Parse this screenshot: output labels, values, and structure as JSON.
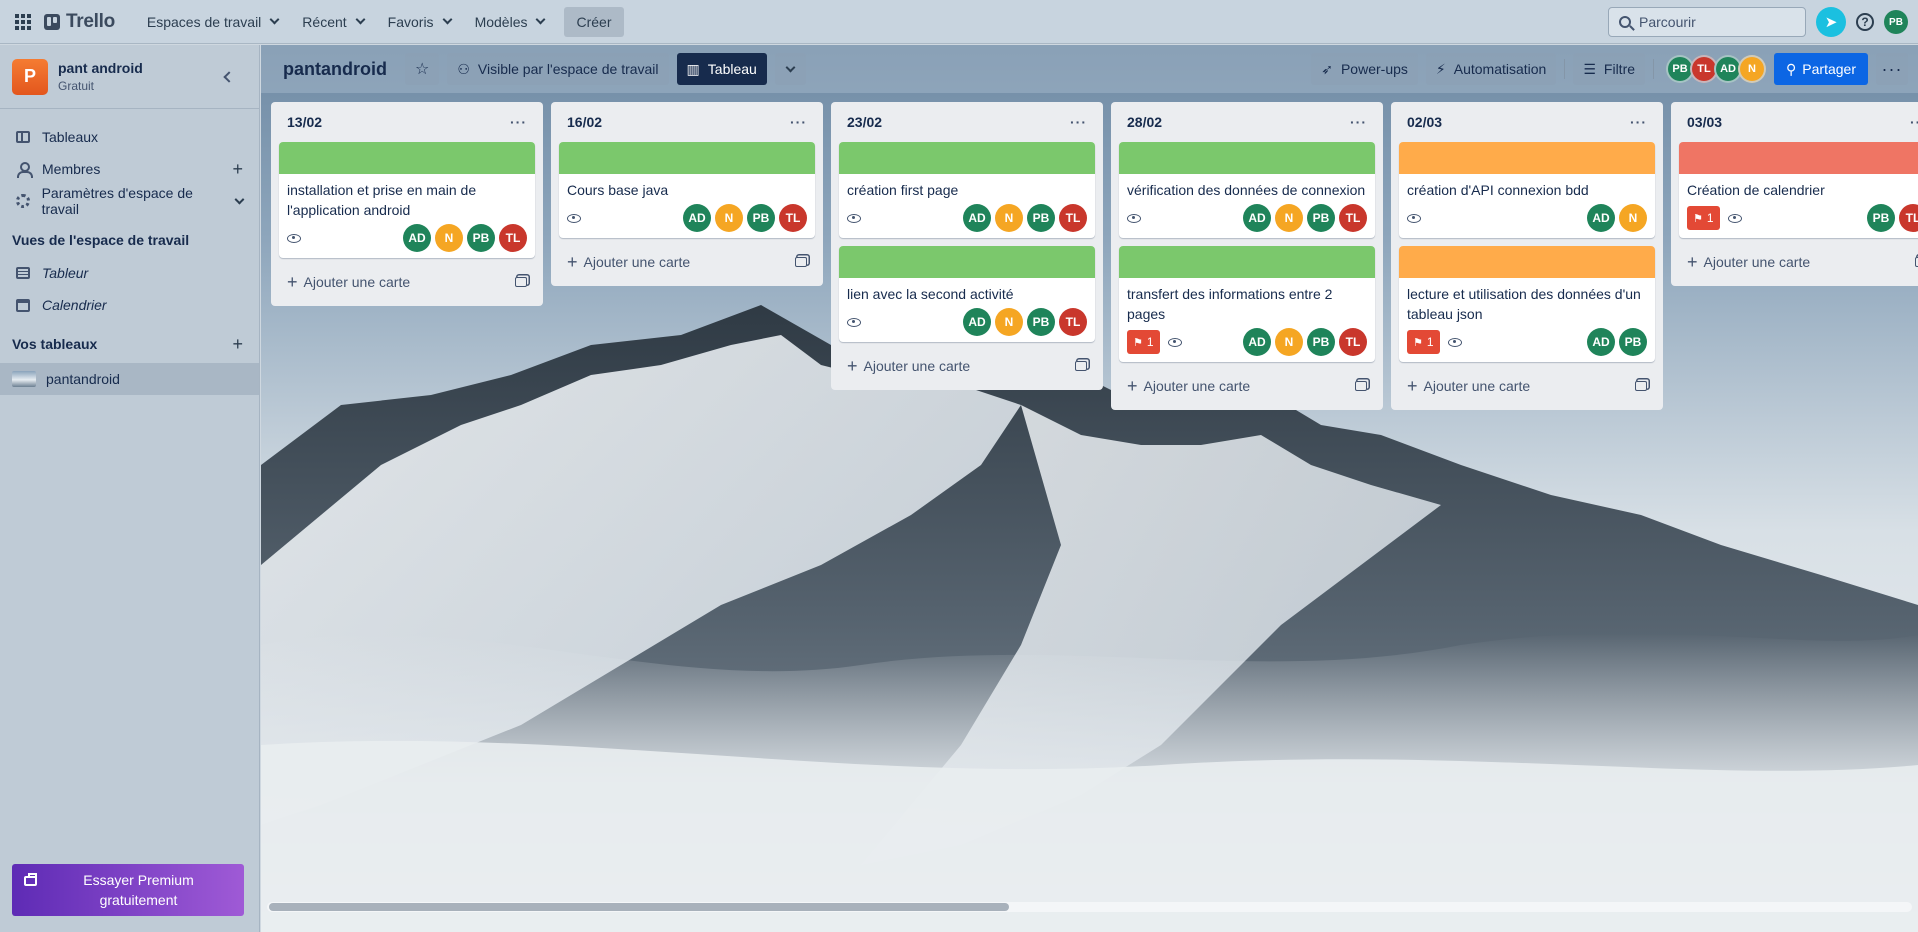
{
  "app": {
    "logo": "Trello"
  },
  "topnav": {
    "items": [
      "Espaces de travail",
      "Récent",
      "Favoris",
      "Modèles"
    ],
    "create": "Créer"
  },
  "search": {
    "placeholder": "Parcourir"
  },
  "current_user": {
    "initials": "PB",
    "color": "#1f845a"
  },
  "sidebar": {
    "workspace_initial": "P",
    "workspace_name": "pant android",
    "workspace_plan": "Gratuit",
    "items": [
      "Tableaux",
      "Membres",
      "Paramètres d'espace de travail"
    ],
    "views_title": "Vues de l'espace de travail",
    "views": [
      "Tableur",
      "Calendrier"
    ],
    "boards_title": "Vos tableaux",
    "boards": [
      "pantandroid"
    ],
    "premium": "Essayer Premium gratuitement"
  },
  "board": {
    "title": "pantandroid",
    "visibility": "Visible par l'espace de travail",
    "view": "Tableau",
    "powerups": "Power-ups",
    "automation": "Automatisation",
    "filter": "Filtre",
    "share": "Partager",
    "members": [
      {
        "initials": "PB",
        "color": "#1f845a"
      },
      {
        "initials": "TL",
        "color": "#c9372c"
      },
      {
        "initials": "AD",
        "color": "#1f845a"
      },
      {
        "initials": "N",
        "color": "#f5a623"
      }
    ]
  },
  "avatars": {
    "AD": "#1f845a",
    "N": "#f5a623",
    "PB": "#1f845a",
    "TL": "#c9372c"
  },
  "lists": [
    {
      "title": "13/02",
      "cards": [
        {
          "cover": "#7bc86c",
          "title": "installation et prise en main de l'application android",
          "badge": null,
          "members": [
            "AD",
            "N",
            "PB",
            "TL"
          ]
        }
      ]
    },
    {
      "title": "16/02",
      "cards": [
        {
          "cover": "#7bc86c",
          "title": "Cours base java",
          "badge": null,
          "members": [
            "AD",
            "N",
            "PB",
            "TL"
          ]
        }
      ]
    },
    {
      "title": "23/02",
      "cards": [
        {
          "cover": "#7bc86c",
          "title": "création first page",
          "badge": null,
          "members": [
            "AD",
            "N",
            "PB",
            "TL"
          ]
        },
        {
          "cover": "#7bc86c",
          "title": "lien avec la second activité",
          "badge": null,
          "members": [
            "AD",
            "N",
            "PB",
            "TL"
          ]
        }
      ]
    },
    {
      "title": "28/02",
      "cards": [
        {
          "cover": "#7bc86c",
          "title": "vérification des données de connexion",
          "badge": null,
          "members": [
            "AD",
            "N",
            "PB",
            "TL"
          ]
        },
        {
          "cover": "#7bc86c",
          "title": "transfert des informations entre 2 pages",
          "badge": "1",
          "members": [
            "AD",
            "N",
            "PB",
            "TL"
          ]
        }
      ]
    },
    {
      "title": "02/03",
      "cards": [
        {
          "cover": "#ffab4a",
          "title": "création d'API connexion bdd",
          "badge": null,
          "members": [
            "AD",
            "N"
          ]
        },
        {
          "cover": "#ffab4a",
          "title": "lecture et utilisation des données d'un tableau json",
          "badge": "1",
          "members": [
            "AD",
            "PB"
          ]
        }
      ]
    },
    {
      "title": "03/03",
      "cards": [
        {
          "cover": "#ef7564",
          "title": "Création de calendrier",
          "badge": "1",
          "members": [
            "PB",
            "TL"
          ]
        }
      ]
    }
  ],
  "add_card_label": "Ajouter une carte",
  "scroll": {
    "position": 0.45
  }
}
